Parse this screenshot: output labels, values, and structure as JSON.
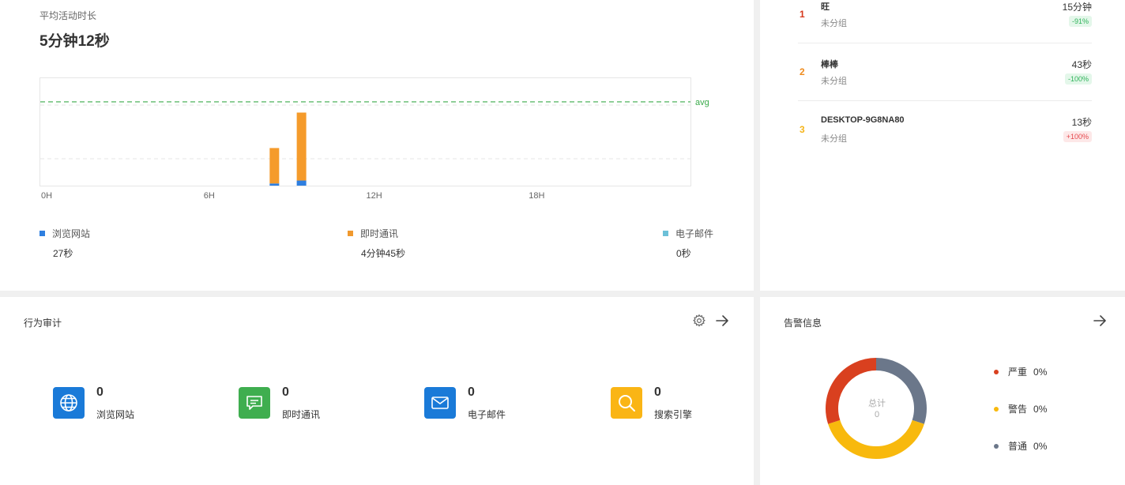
{
  "activity": {
    "title": "平均活动时长",
    "value": "5分钟12秒",
    "chart_data": {
      "type": "bar",
      "stacked": true,
      "x_ticks": [
        "0H",
        "6H",
        "12H",
        "18H"
      ],
      "x_domain_hours": [
        0,
        24
      ],
      "avg_label": "avg",
      "avg_seconds": 312,
      "y_range_seconds": [
        0,
        400
      ],
      "grid": true,
      "series": [
        {
          "name": "浏览网站",
          "color": "#2e7fe0",
          "hour_values": [
            {
              "hour": 8,
              "value": 8
            },
            {
              "hour": 9,
              "value": 19
            }
          ]
        },
        {
          "name": "即时通讯",
          "color": "#f59b2b",
          "hour_values": [
            {
              "hour": 8,
              "value": 132
            },
            {
              "hour": 9,
              "value": 253
            }
          ]
        },
        {
          "name": "电子邮件",
          "color": "#6cc0d8",
          "hour_values": []
        }
      ]
    },
    "legend": [
      {
        "label": "浏览网站",
        "value": "27秒",
        "color": "#2e7fe0"
      },
      {
        "label": "即时通讯",
        "value": "4分钟45秒",
        "color": "#f0992e"
      },
      {
        "label": "电子邮件",
        "value": "0秒",
        "color": "#6cc0d8"
      }
    ]
  },
  "ranking": [
    {
      "rank": "1",
      "name": "旺",
      "group": "未分组",
      "duration": "15分钟",
      "change": "-91%",
      "rank_color": "#d6381c"
    },
    {
      "rank": "2",
      "name": "棒棒",
      "group": "未分组",
      "duration": "43秒",
      "change": "-100%",
      "rank_color": "#ef8b1e"
    },
    {
      "rank": "3",
      "name": "DESKTOP-9G8NA80",
      "group": "未分组",
      "duration": "13秒",
      "change": "+100%",
      "rank_color": "#f5b41a"
    }
  ],
  "audit": {
    "title": "行为审计",
    "settings_icon": "gear-icon",
    "arrow_icon": "arrow-right-icon",
    "items": [
      {
        "count": "0",
        "label": "浏览网站",
        "icon": "globe-icon",
        "color": "#1a7ad8"
      },
      {
        "count": "0",
        "label": "即时通讯",
        "icon": "chat-icon",
        "color": "#3fae4f"
      },
      {
        "count": "0",
        "label": "电子邮件",
        "icon": "mail-icon",
        "color": "#1a7ad8"
      },
      {
        "count": "0",
        "label": "搜索引擎",
        "icon": "search-icon",
        "color": "#fab515"
      }
    ]
  },
  "alerts": {
    "title": "告警信息",
    "arrow_icon": "arrow-right-icon",
    "total_label": "总计",
    "total_value": "0",
    "legend": [
      {
        "label": "严重",
        "pct": "0%",
        "color": "#d9401f"
      },
      {
        "label": "警告",
        "pct": "0%",
        "color": "#f8b90d"
      },
      {
        "label": "普通",
        "pct": "0%",
        "color": "#6b778a"
      }
    ]
  }
}
